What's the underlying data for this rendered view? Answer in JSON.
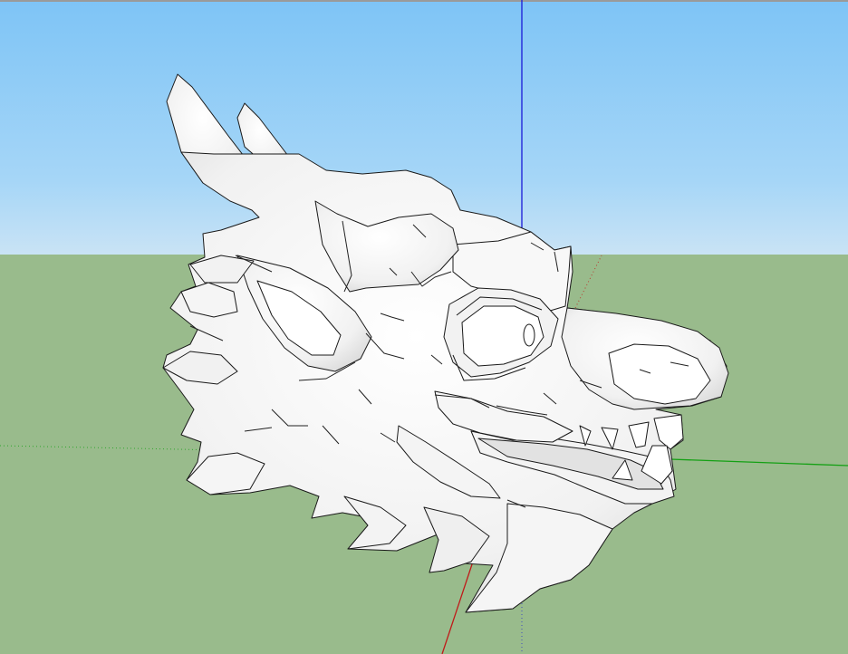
{
  "scene": {
    "model": "dragon-head",
    "colors": {
      "sky_top": "#7ec4f6",
      "sky_horizon": "#c9e3f5",
      "ground": "#99bb8c",
      "axis_blue": "#1a1ad8",
      "axis_red": "#c01818",
      "axis_green": "#14a014",
      "model_face": "#f7f7f7",
      "model_edge": "#1a1a1a"
    }
  }
}
